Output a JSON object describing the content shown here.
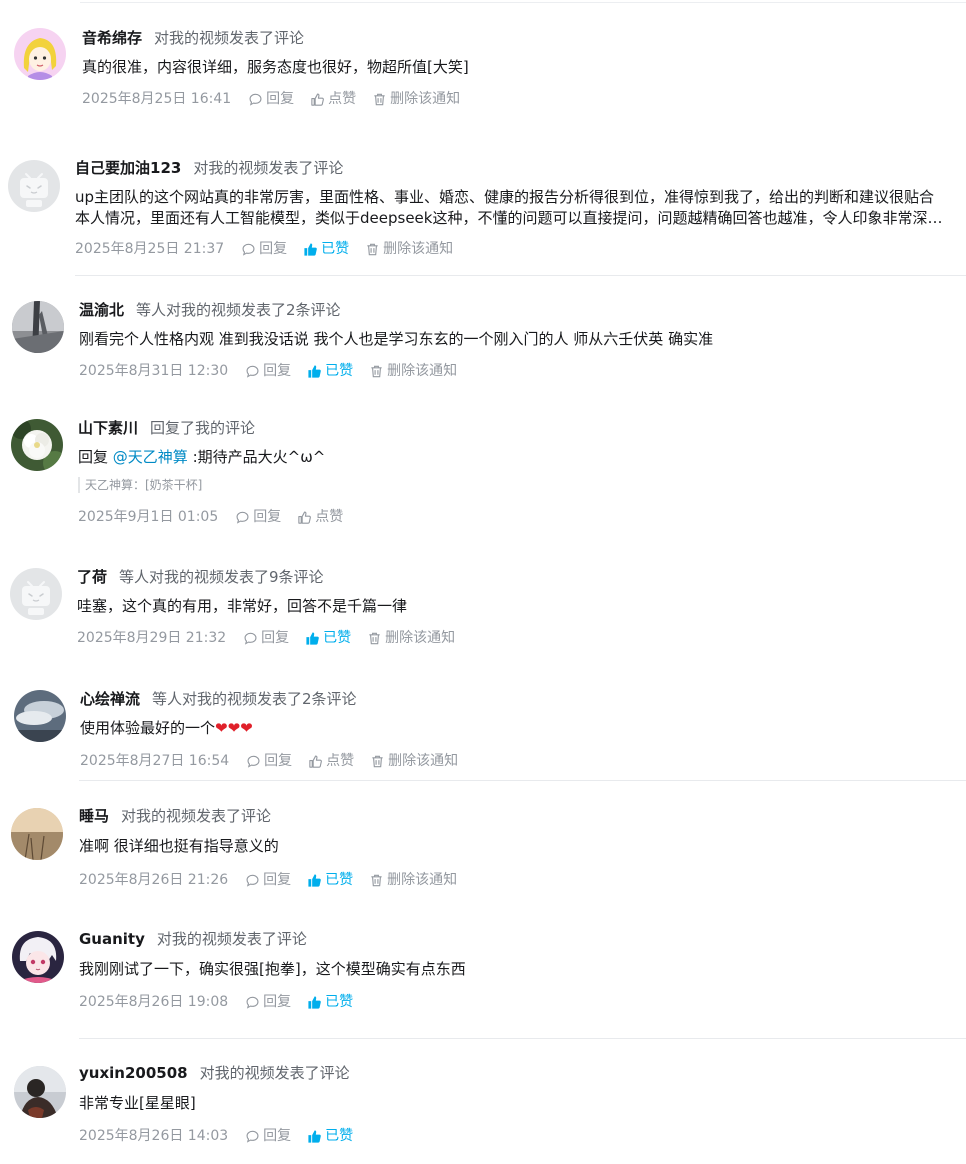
{
  "items": [
    {
      "user": "音希绵存",
      "action": "对我的视频发表了评论",
      "content": "真的很准，内容很详细，服务态度也很好，物超所值[大笑]",
      "time": "2025年8月25日 16:41",
      "reply": "回复",
      "like": "点赞",
      "delete": "删除该通知",
      "liked": false,
      "avatar_icon": "cartoon-girl-avatar"
    },
    {
      "user": "自己要加油123",
      "action": "对我的视频发表了评论",
      "content_line1": "up主团队的这个网站真的非常厉害，里面性格、事业、婚恋、健康的报告分析得很到位，准得惊到我了，给出的判断和建议很贴合",
      "content_line2": "本人情况，里面还有人工智能模型，类似于deepseek这种，不懂的问题可以直接提问，问题越精确回答也越准，令人印象非常深刻，推荐大家去试试",
      "time": "2025年8月25日 21:37",
      "reply": "回复",
      "like": "已赞",
      "delete": "删除该通知",
      "liked": true,
      "avatar_icon": "default-tv-avatar"
    },
    {
      "user": "温渝北",
      "action": "等人对我的视频发表了2条评论",
      "content": "刚看完个人性格内观 准到我没话说 我个人也是学习东玄的一个刚入门的人 师从六壬伏英 确实准",
      "time": "2025年8月31日 12:30",
      "reply": "回复",
      "like": "已赞",
      "delete": "删除该通知",
      "liked": true,
      "avatar_icon": "sky-building-avatar"
    },
    {
      "user": "山下素川",
      "action": "回复了我的评论",
      "reply_prefix": "回复 ",
      "mention": "@天乙神算",
      "content": " :期待产品大火^ω^",
      "quote": "天乙神算：[奶茶干杯]",
      "time": "2025年9月1日 01:05",
      "reply": "回复",
      "like": "点赞",
      "liked": false,
      "avatar_icon": "white-flower-avatar"
    },
    {
      "user": "了荷",
      "action": "等人对我的视频发表了9条评论",
      "content": "哇塞，这个真的有用，非常好，回答不是千篇一律",
      "time": "2025年8月29日 21:32",
      "reply": "回复",
      "like": "已赞",
      "delete": "删除该通知",
      "liked": true,
      "avatar_icon": "default-tv-avatar"
    },
    {
      "user": "心绘禅流",
      "action": "等人对我的视频发表了2条评论",
      "content": "使用体验最好的一个",
      "hearts": "❤❤❤",
      "time": "2025年8月27日 16:54",
      "reply": "回复",
      "like": "点赞",
      "delete": "删除该通知",
      "liked": false,
      "avatar_icon": "cloud-sky-avatar"
    },
    {
      "user": "睡马",
      "action": "对我的视频发表了评论",
      "content": "准啊 很详细也挺有指导意义的",
      "time": "2025年8月26日 21:26",
      "reply": "回复",
      "like": "已赞",
      "delete": "删除该通知",
      "liked": true,
      "avatar_icon": "sunset-field-avatar"
    },
    {
      "user": "Guanity",
      "action": "对我的视频发表了评论",
      "content": "我刚刚试了一下，确实很强[抱拳]，这个模型确实有点东西",
      "time": "2025年8月26日 19:08",
      "reply": "回复",
      "like": "已赞",
      "liked": true,
      "avatar_icon": "anime-character-avatar"
    },
    {
      "user": "yuxin200508",
      "action": "对我的视频发表了评论",
      "content": "非常专业[星星眼]",
      "time": "2025年8月26日 14:03",
      "reply": "回复",
      "like": "已赞",
      "liked": true,
      "avatar_icon": "dark-person-avatar"
    }
  ],
  "colors": {
    "accent_liked": "#00aeec",
    "mention": "#008ac5",
    "meta_gray": "#9499a0",
    "action_gray": "#61666d"
  }
}
